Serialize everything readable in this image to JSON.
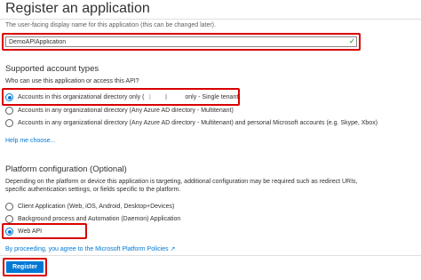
{
  "page": {
    "title": "Register an application"
  },
  "name_field": {
    "description": "The user-facing display name for this application (this can be changed later).",
    "value": "DemoAPIApplication",
    "valid_icon": "checkmark-icon",
    "valid_color": "#107c10"
  },
  "account_types": {
    "heading": "Supported account types",
    "question": "Who can use this application or access this API?",
    "options": [
      {
        "label_start": "Accounts in this organizational directory only (",
        "label_end": " only - Single tenant)",
        "selected": true
      },
      {
        "label": "Accounts in any organizational directory (Any Azure AD directory - Multitenant)",
        "selected": false
      },
      {
        "label": "Accounts in any organizational directory (Any Azure AD directory - Multitenant) and personal Microsoft accounts (e.g. Skype, Xbox)",
        "selected": false
      }
    ],
    "help_link": "Help me choose..."
  },
  "platform": {
    "heading": "Platform configuration (Optional)",
    "description": "Depending on the platform or device this application is targeting, additional configuration may be required such as redirect URIs, specific authentication settings, or fields specific to the platform.",
    "options": [
      {
        "label": "Client Application (Web, iOS, Android, Desktop+Devices)",
        "selected": false
      },
      {
        "label": "Background process and Automation (Daemon) Application",
        "selected": false
      },
      {
        "label": "Web API",
        "selected": true
      }
    ]
  },
  "footer": {
    "policy_text": "By proceeding, you agree to the Microsoft Platform Policies",
    "policy_icon": "external-link-icon",
    "register_label": "Register"
  },
  "colors": {
    "accent": "#0078d4",
    "highlight": "#d90000"
  }
}
